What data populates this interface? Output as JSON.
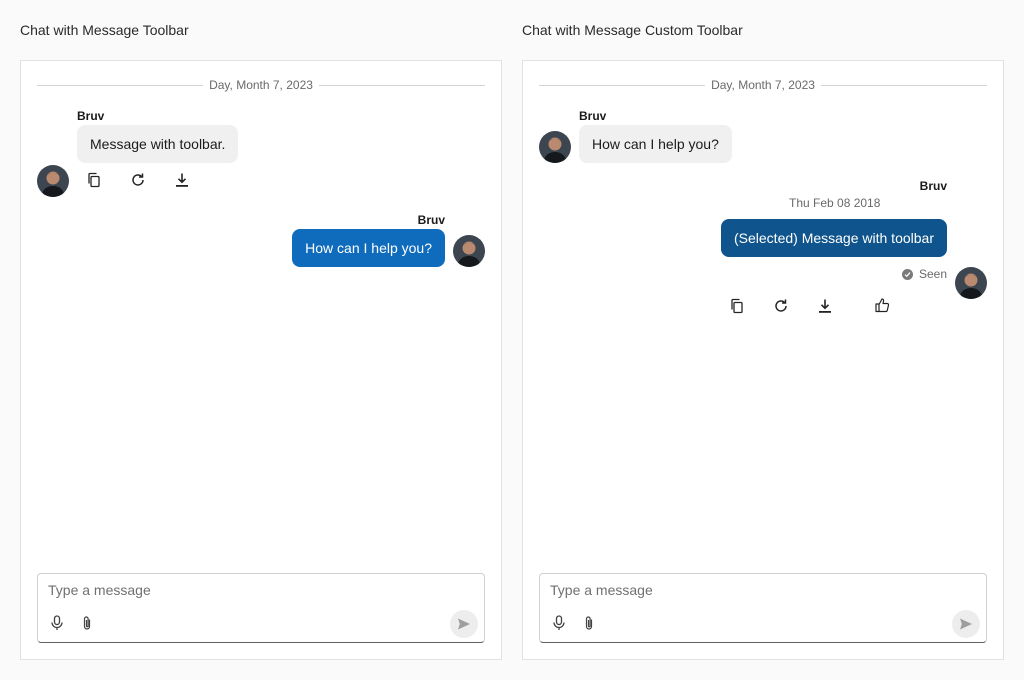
{
  "left": {
    "title": "Chat with Message Toolbar",
    "date_divider": "Day, Month 7, 2023",
    "received": {
      "author": "Bruv",
      "text": "Message with toolbar."
    },
    "toolbar_icons": [
      "copy-icon",
      "refresh-icon",
      "download-icon"
    ],
    "sent": {
      "author": "Bruv",
      "text": "How can I help you?"
    },
    "composer": {
      "placeholder": "Type a message"
    }
  },
  "right": {
    "title": "Chat with Message Custom Toolbar",
    "date_divider": "Day, Month 7, 2023",
    "received": {
      "author": "Bruv",
      "text": "How can I help you?"
    },
    "sent": {
      "author": "Bruv",
      "timestamp": "Thu Feb 08 2018",
      "text": "(Selected) Message with toolbar",
      "status": "Seen"
    },
    "toolbar_icons": [
      "copy-icon",
      "refresh-icon",
      "download-icon",
      "thumbs-up-icon"
    ],
    "composer": {
      "placeholder": "Type a message"
    }
  },
  "icons": {
    "mic": "microphone-icon",
    "attach": "paperclip-icon",
    "send": "send-icon"
  },
  "colors": {
    "sent_bubble": "#0f6cbd",
    "selected_bubble": "#0f548c",
    "received_bubble": "#f0f0f0"
  }
}
